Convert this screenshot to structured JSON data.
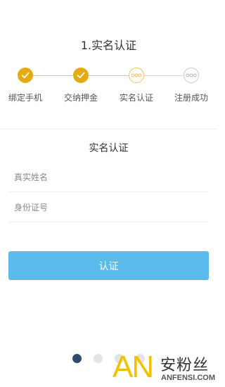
{
  "header": {
    "title": "1.实名认证"
  },
  "steps": [
    {
      "label": "绑定手机",
      "state": "done",
      "icon": "check-icon"
    },
    {
      "label": "交纳押金",
      "state": "done",
      "icon": "check-icon"
    },
    {
      "label": "实名认证",
      "state": "current",
      "icon": "ellipsis-icon"
    },
    {
      "label": "注册成功",
      "state": "pending",
      "icon": "ellipsis-icon"
    }
  ],
  "form": {
    "title": "实名认证",
    "name_placeholder": "真实姓名",
    "id_placeholder": "身份证号",
    "submit_label": "认证"
  },
  "pager": {
    "total": 4,
    "active_index": 0
  },
  "watermark": {
    "logo_letters": "AN",
    "brand": "安粉丝",
    "url": "ANFENSI.COM"
  },
  "colors": {
    "accent": "#e6ab12",
    "accent_light": "#efc35a",
    "pending": "#c8c8c8",
    "button": "#5bbbeb",
    "dot_active": "#2f4a6e",
    "dot_inactive": "#e4e4e4"
  }
}
